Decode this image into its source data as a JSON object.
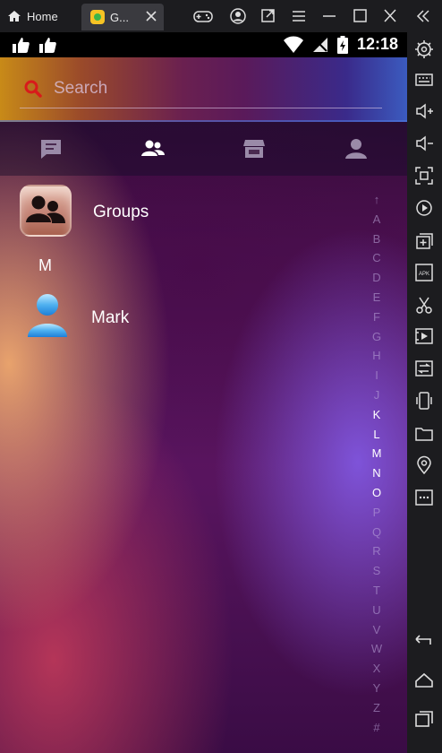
{
  "window": {
    "home_tab": "Home",
    "app_tab": "G..."
  },
  "status_bar": {
    "time": "12:18"
  },
  "search": {
    "placeholder": "Search"
  },
  "tabs": [
    {
      "icon": "chat-icon",
      "active": false
    },
    {
      "icon": "contacts-icon",
      "active": true
    },
    {
      "icon": "store-icon",
      "active": false
    },
    {
      "icon": "profile-icon",
      "active": false
    }
  ],
  "list": {
    "groups_label": "Groups",
    "section_letter": "M",
    "contacts": [
      {
        "name": "Mark",
        "icon": "person-avatar-icon"
      }
    ]
  },
  "alphabet_index": [
    "↑",
    "A",
    "B",
    "C",
    "D",
    "E",
    "F",
    "G",
    "H",
    "I",
    "J",
    "K",
    "L",
    "M",
    "N",
    "O",
    "P",
    "Q",
    "R",
    "S",
    "T",
    "U",
    "V",
    "W",
    "X",
    "Y",
    "Z",
    "#"
  ],
  "alphabet_highlighted": [
    "K",
    "L",
    "M",
    "N",
    "O"
  ],
  "colors": {
    "accent_search_icon": "#d81b1b",
    "tab_active": "#ffffff",
    "tab_inactive": "#9a8aa8"
  }
}
